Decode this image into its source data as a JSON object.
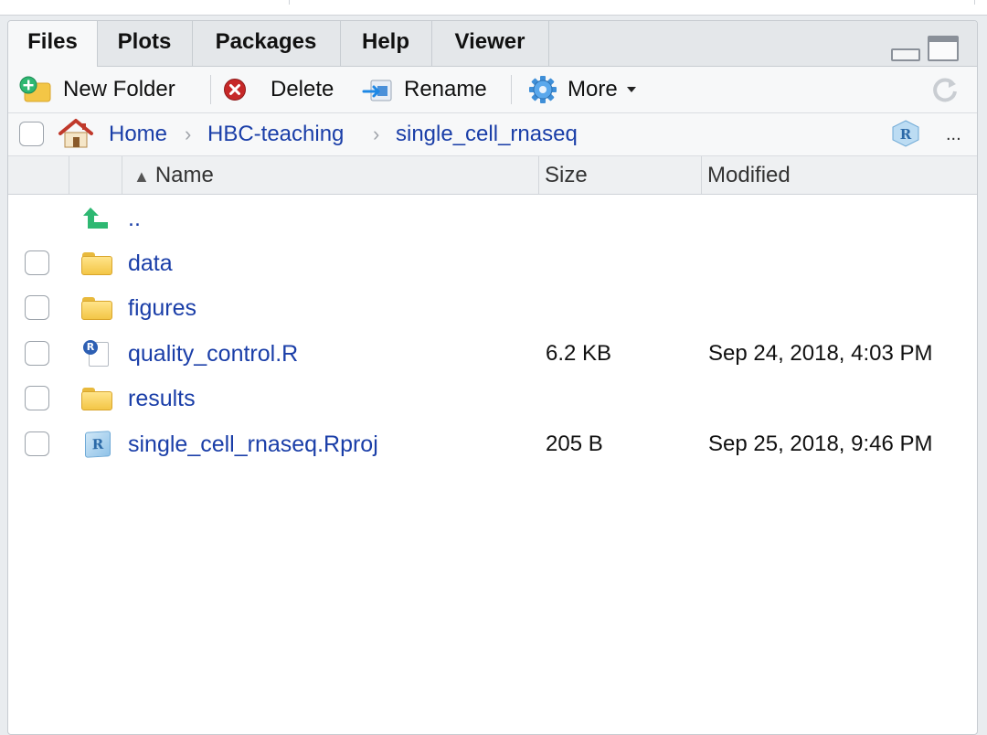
{
  "tabs": [
    {
      "label": "Files",
      "active": true
    },
    {
      "label": "Plots"
    },
    {
      "label": "Packages"
    },
    {
      "label": "Help"
    },
    {
      "label": "Viewer"
    }
  ],
  "toolbar": {
    "new_folder": "New Folder",
    "delete": "Delete",
    "rename": "Rename",
    "more": "More"
  },
  "breadcrumb": {
    "home": "Home",
    "items": [
      "HBC-teaching",
      "single_cell_rnaseq"
    ],
    "overflow": "..."
  },
  "columns": {
    "name": "Name",
    "size": "Size",
    "modified": "Modified",
    "sort_indicator": "▲"
  },
  "parent_dir": "..",
  "files": [
    {
      "name": "data",
      "type": "folder",
      "size": "",
      "modified": ""
    },
    {
      "name": "figures",
      "type": "folder",
      "size": "",
      "modified": ""
    },
    {
      "name": "quality_control.R",
      "type": "r-script",
      "size": "6.2 KB",
      "modified": "Sep 24, 2018, 4:03 PM"
    },
    {
      "name": "results",
      "type": "folder",
      "size": "",
      "modified": ""
    },
    {
      "name": "single_cell_rnaseq.Rproj",
      "type": "rproj",
      "size": "205 B",
      "modified": "Sep 25, 2018, 9:46 PM"
    }
  ],
  "icons": {
    "new_folder": "new-folder-icon",
    "delete": "delete-icon",
    "rename": "rename-icon",
    "more": "gear-icon",
    "refresh": "refresh-icon",
    "home": "home-icon",
    "project": "rproj-icon"
  },
  "colors": {
    "link": "#1a3ea8",
    "folder": "#f3c646",
    "delete_red": "#c62828",
    "up_green": "#2eb872"
  }
}
